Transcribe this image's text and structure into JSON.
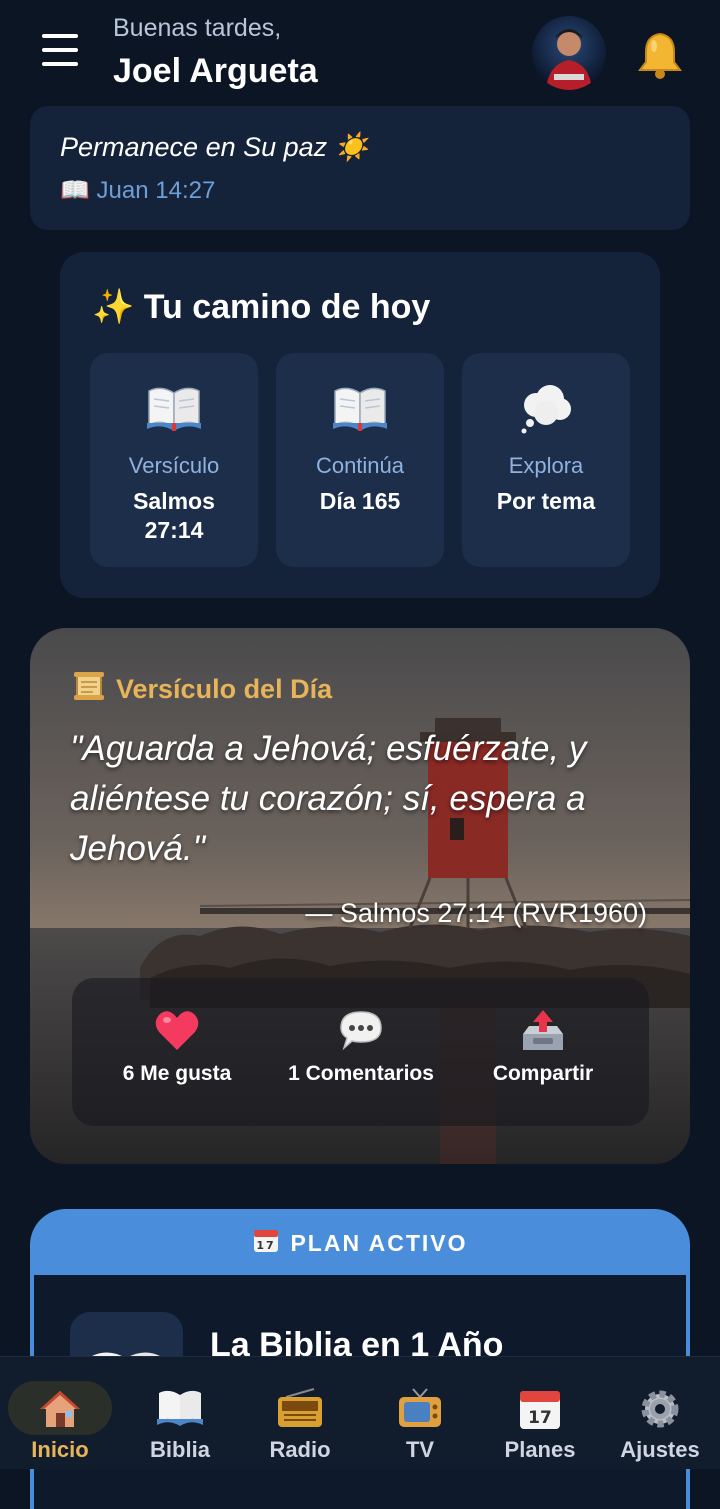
{
  "header": {
    "greeting": "Buenas tardes,",
    "username": "Joel Argueta"
  },
  "peace": {
    "title": "Permanece en Su paz ☀️",
    "reference": "📖 Juan 14:27"
  },
  "camino": {
    "title": "✨ Tu camino de hoy",
    "tiles": [
      {
        "label": "Versículo",
        "value": "Salmos 27:14",
        "icon": "open-book-icon"
      },
      {
        "label": "Continúa",
        "value": "Día 165",
        "icon": "open-book-icon"
      },
      {
        "label": "Explora",
        "value": "Por tema",
        "icon": "thought-bubble-icon"
      }
    ]
  },
  "verse": {
    "heading": "Versículo del Día",
    "text": "\"Aguarda a Jehová; esfuérzate, y aliéntese tu corazón; sí, espera a Jehová.\"",
    "reference": "— Salmos 27:14 (RVR1960)",
    "actions": [
      {
        "label": "6 Me gusta",
        "icon": "heart-icon"
      },
      {
        "label": "1 Comentarios",
        "icon": "comment-icon"
      },
      {
        "label": "Compartir",
        "icon": "share-icon"
      }
    ]
  },
  "plan": {
    "badge": "PLAN ACTIVO",
    "title": "La Biblia en 1 Año"
  },
  "nav": {
    "items": [
      {
        "label": "Inicio",
        "icon": "home-icon"
      },
      {
        "label": "Biblia",
        "icon": "bible-icon"
      },
      {
        "label": "Radio",
        "icon": "radio-icon"
      },
      {
        "label": "TV",
        "icon": "tv-icon"
      },
      {
        "label": "Planes",
        "icon": "calendar-icon"
      },
      {
        "label": "Ajustes",
        "icon": "gear-icon"
      }
    ],
    "active": "Inicio"
  },
  "colors": {
    "background": "#0b1524",
    "card": "#14233a",
    "accent_gold": "#e8b45a",
    "accent_blue": "#4a8edb",
    "link_blue": "#6e9fd6"
  }
}
